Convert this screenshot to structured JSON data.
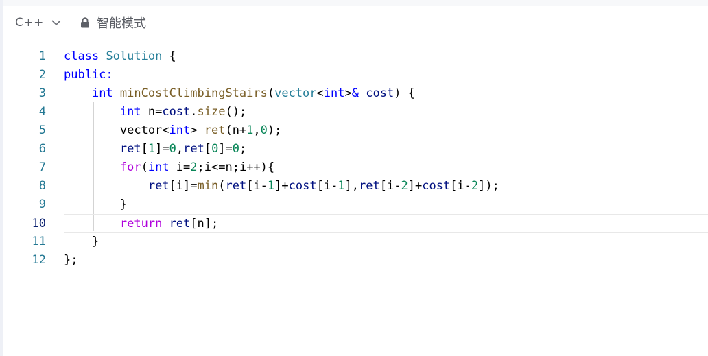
{
  "toolbar": {
    "language": "C++",
    "mode_label": "智能模式"
  },
  "icons": {
    "language_dropdown": "chevron-down-icon",
    "mode": "lock-icon"
  },
  "editor": {
    "current_line": 10,
    "lines": [
      {
        "num": "1",
        "tokens": [
          {
            "t": "class ",
            "k": "kw"
          },
          {
            "t": "Solution",
            "k": "cls"
          },
          {
            "t": " {",
            "k": "def"
          }
        ]
      },
      {
        "num": "2",
        "tokens": [
          {
            "t": "public:",
            "k": "kw"
          }
        ]
      },
      {
        "num": "3",
        "tokens": [
          {
            "t": "    ",
            "k": "def"
          },
          {
            "t": "int",
            "k": "kw"
          },
          {
            "t": " ",
            "k": "def"
          },
          {
            "t": "minCostClimbingStairs",
            "k": "fn"
          },
          {
            "t": "(",
            "k": "def"
          },
          {
            "t": "vector",
            "k": "cls"
          },
          {
            "t": "<",
            "k": "def"
          },
          {
            "t": "int",
            "k": "kw"
          },
          {
            "t": ">",
            "k": "def"
          },
          {
            "t": "&",
            "k": "kw"
          },
          {
            "t": " ",
            "k": "def"
          },
          {
            "t": "cost",
            "k": "var"
          },
          {
            "t": ") {",
            "k": "def"
          }
        ]
      },
      {
        "num": "4",
        "tokens": [
          {
            "t": "        ",
            "k": "def"
          },
          {
            "t": "int",
            "k": "kw"
          },
          {
            "t": " n=",
            "k": "def"
          },
          {
            "t": "cost",
            "k": "var"
          },
          {
            "t": ".",
            "k": "def"
          },
          {
            "t": "size",
            "k": "fn"
          },
          {
            "t": "();",
            "k": "def"
          }
        ]
      },
      {
        "num": "5",
        "tokens": [
          {
            "t": "        vector<",
            "k": "def"
          },
          {
            "t": "int",
            "k": "kw"
          },
          {
            "t": "> ",
            "k": "def"
          },
          {
            "t": "ret",
            "k": "fn"
          },
          {
            "t": "(n+",
            "k": "def"
          },
          {
            "t": "1",
            "k": "num"
          },
          {
            "t": ",",
            "k": "def"
          },
          {
            "t": "0",
            "k": "num"
          },
          {
            "t": ");",
            "k": "def"
          }
        ]
      },
      {
        "num": "6",
        "tokens": [
          {
            "t": "        ",
            "k": "def"
          },
          {
            "t": "ret",
            "k": "var"
          },
          {
            "t": "[",
            "k": "def"
          },
          {
            "t": "1",
            "k": "num"
          },
          {
            "t": "]=",
            "k": "def"
          },
          {
            "t": "0",
            "k": "num"
          },
          {
            "t": ",",
            "k": "def"
          },
          {
            "t": "ret",
            "k": "var"
          },
          {
            "t": "[",
            "k": "def"
          },
          {
            "t": "0",
            "k": "num"
          },
          {
            "t": "]=",
            "k": "def"
          },
          {
            "t": "0",
            "k": "num"
          },
          {
            "t": ";",
            "k": "def"
          }
        ]
      },
      {
        "num": "7",
        "tokens": [
          {
            "t": "        ",
            "k": "def"
          },
          {
            "t": "for",
            "k": "ctl"
          },
          {
            "t": "(",
            "k": "def"
          },
          {
            "t": "int",
            "k": "kw"
          },
          {
            "t": " i=",
            "k": "def"
          },
          {
            "t": "2",
            "k": "num"
          },
          {
            "t": ";i<=n;i++){",
            "k": "def"
          }
        ]
      },
      {
        "num": "8",
        "tokens": [
          {
            "t": "            ",
            "k": "def"
          },
          {
            "t": "ret",
            "k": "var"
          },
          {
            "t": "[i]=",
            "k": "def"
          },
          {
            "t": "min",
            "k": "fn"
          },
          {
            "t": "(",
            "k": "def"
          },
          {
            "t": "ret",
            "k": "var"
          },
          {
            "t": "[i-",
            "k": "def"
          },
          {
            "t": "1",
            "k": "num"
          },
          {
            "t": "]+",
            "k": "def"
          },
          {
            "t": "cost",
            "k": "var"
          },
          {
            "t": "[i-",
            "k": "def"
          },
          {
            "t": "1",
            "k": "num"
          },
          {
            "t": "],",
            "k": "def"
          },
          {
            "t": "ret",
            "k": "var"
          },
          {
            "t": "[i-",
            "k": "def"
          },
          {
            "t": "2",
            "k": "num"
          },
          {
            "t": "]+",
            "k": "def"
          },
          {
            "t": "cost",
            "k": "var"
          },
          {
            "t": "[i-",
            "k": "def"
          },
          {
            "t": "2",
            "k": "num"
          },
          {
            "t": "]);",
            "k": "def"
          }
        ]
      },
      {
        "num": "9",
        "tokens": [
          {
            "t": "        }",
            "k": "def"
          }
        ]
      },
      {
        "num": "10",
        "tokens": [
          {
            "t": "        ",
            "k": "def"
          },
          {
            "t": "return",
            "k": "ctl"
          },
          {
            "t": " ",
            "k": "def"
          },
          {
            "t": "ret",
            "k": "var"
          },
          {
            "t": "[n];",
            "k": "def"
          }
        ]
      },
      {
        "num": "11",
        "tokens": [
          {
            "t": "    }",
            "k": "def"
          }
        ]
      },
      {
        "num": "12",
        "tokens": [
          {
            "t": "};",
            "k": "def"
          }
        ]
      }
    ]
  }
}
